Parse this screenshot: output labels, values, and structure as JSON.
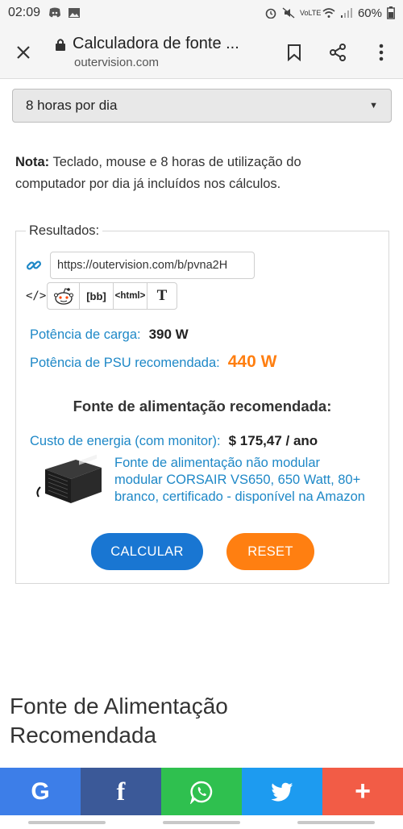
{
  "status_bar": {
    "time": "02:09",
    "battery": "60%",
    "network": "VoLTE"
  },
  "browser": {
    "title": "Calculadora de fonte ...",
    "url": "outervision.com"
  },
  "form": {
    "usage_select_value": "8 horas por dia"
  },
  "note": {
    "label": "Nota:",
    "text": "Teclado, mouse e 8 horas de utilização do computador por dia já incluídos nos cálculos."
  },
  "results": {
    "legend": "Resultados:",
    "share_url": "https://outervision.com/b/pvna2H",
    "share_buttons": [
      "[bb]",
      "<html>",
      "T"
    ],
    "load_power_label": "Potência de carga:",
    "load_power_value": "390 W",
    "psu_power_label": "Potência de PSU recomendada:",
    "psu_power_value": "440 W",
    "psu_heading": "Fonte de alimentação recomendada:",
    "energy_cost_label": "Custo de energia (com monitor):",
    "energy_cost_value": "$ 175,47 / ano",
    "product_text": "Fonte de alimentação não modular modular CORSAIR VS650, 650 Watt, 80+ branco, certificado - disponível na Amazon",
    "calculate_label": "CALCULAR",
    "reset_label": "RESET"
  },
  "section": {
    "title": "Fonte de Alimentação Recomendada"
  },
  "share_bar": {
    "items": [
      {
        "label": "G",
        "color": "#3d7ee8"
      },
      {
        "label": "f",
        "color": "#3b5998"
      },
      {
        "label": "whatsapp",
        "color": "#2fc04f"
      },
      {
        "label": "twitter",
        "color": "#1d9bf0"
      },
      {
        "label": "+",
        "color": "#f25c46"
      }
    ]
  }
}
